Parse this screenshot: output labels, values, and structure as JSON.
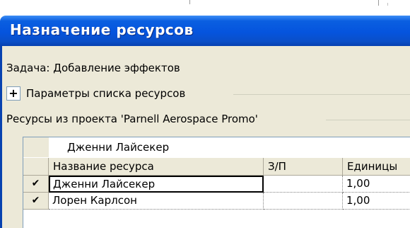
{
  "dialog": {
    "title": "Назначение ресурсов",
    "task_label": "Задача: Добавление эффектов",
    "expand_button": "+",
    "params_label": "Параметры списка ресурсов",
    "resources_label": "Ресурсы из проекта 'Parnell Aerospace Promo'"
  },
  "grid": {
    "edit_value": "Дженни Лайсекер",
    "columns": [
      "Название ресурса",
      "З/П",
      "Единицы"
    ],
    "rows": [
      {
        "check": "✔",
        "name": "Дженни Лайсекер",
        "zp": "",
        "units": "1,00"
      },
      {
        "check": "✔",
        "name": "Лорен Карлсон",
        "zp": "",
        "units": "1,00"
      }
    ]
  },
  "colors": {
    "titlebar": "#0554de",
    "face": "#ece9d8",
    "border": "#7f9db9"
  }
}
